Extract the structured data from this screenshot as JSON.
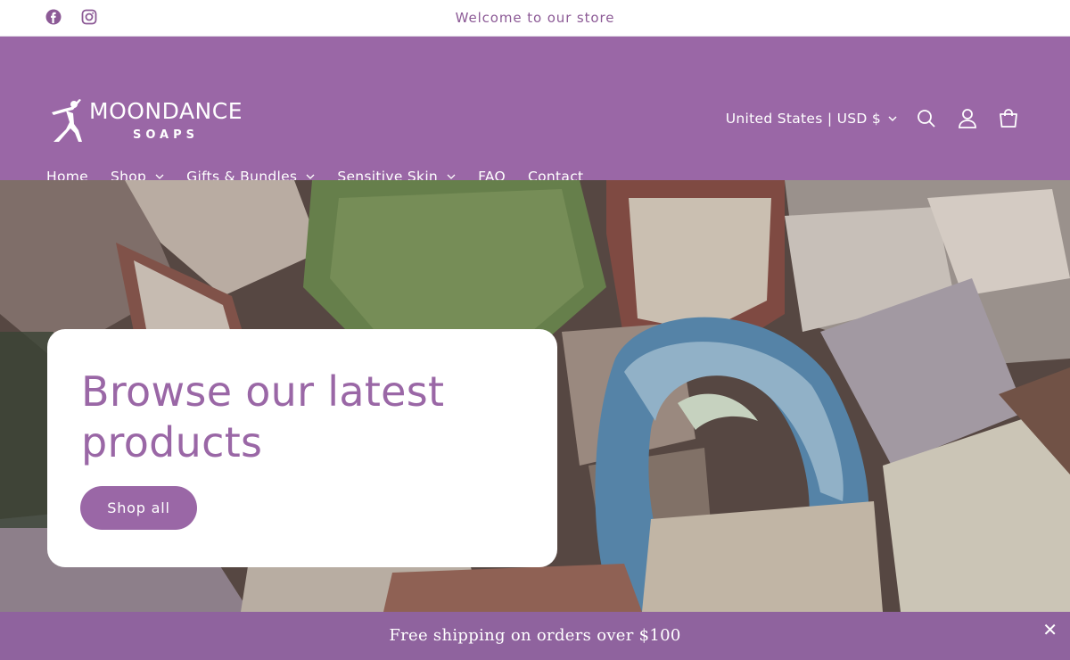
{
  "announcement": {
    "text": "Welcome to our store",
    "social": [
      {
        "icon": "facebook-icon"
      },
      {
        "icon": "instagram-icon"
      }
    ]
  },
  "brand": {
    "name": "MOONDANCE",
    "subtitle": "SOAPS",
    "color": "#9a67a6"
  },
  "header": {
    "locale": "United States | USD $",
    "icons": [
      "search-icon",
      "account-icon",
      "cart-icon"
    ]
  },
  "nav": [
    {
      "label": "Home",
      "active": true,
      "dropdown": false
    },
    {
      "label": "Shop",
      "active": false,
      "dropdown": true
    },
    {
      "label": "Gifts & Bundles",
      "active": false,
      "dropdown": true
    },
    {
      "label": "Sensitive Skin",
      "active": false,
      "dropdown": true
    },
    {
      "label": "FAQ",
      "active": false,
      "dropdown": false
    },
    {
      "label": "Contact",
      "active": false,
      "dropdown": false
    }
  ],
  "hero": {
    "title": "Browse our latest products",
    "button_label": "Shop all"
  },
  "promo": {
    "text": "Free shipping on orders over $100",
    "close_icon": "close-icon"
  }
}
